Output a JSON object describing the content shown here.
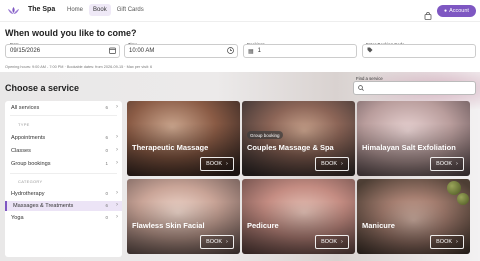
{
  "header": {
    "brand": "The Spa",
    "nav": [
      "Home",
      "Book",
      "Gift Cards"
    ],
    "account_label": "Account"
  },
  "when": {
    "title": "When would you like to come?",
    "date_label": "Date",
    "date_value": "09/15/2026",
    "time_label": "Time",
    "time_value": "10:00 AM",
    "bookings_label": "Bookings",
    "bookings_value": "1",
    "code_label": "Enter Booking Code",
    "hint": "Opening hours: 9:00 AM - 7:00 PM · Bookable dates: from 2026-09-15 · Max per visit: 6"
  },
  "choose": {
    "title": "Choose a service",
    "find_label": "Find a service",
    "find_placeholder": ""
  },
  "sidebar": {
    "all": {
      "label": "All services",
      "count": "6"
    },
    "type_head": "TYPE",
    "types": [
      {
        "label": "Appointments",
        "count": "6"
      },
      {
        "label": "Classes",
        "count": "0"
      },
      {
        "label": "Group bookings",
        "count": "1"
      }
    ],
    "cat_head": "CATEGORY",
    "cats": [
      {
        "label": "Hydrotherapy",
        "count": "0"
      },
      {
        "label": "Massages & Treatments",
        "count": "6"
      },
      {
        "label": "Yoga",
        "count": "0"
      }
    ]
  },
  "services": [
    {
      "title": "Therapeutic Massage",
      "book": "BOOK",
      "badge": ""
    },
    {
      "title": "Couples Massage & Spa",
      "book": "BOOK",
      "badge": "Group booking"
    },
    {
      "title": "Himalayan Salt Exfoliation",
      "book": "BOOK",
      "badge": ""
    },
    {
      "title": "Flawless Skin Facial",
      "book": "BOOK",
      "badge": ""
    },
    {
      "title": "Pedicure",
      "book": "BOOK",
      "badge": ""
    },
    {
      "title": "Manicure",
      "book": "BOOK",
      "badge": ""
    }
  ],
  "colors": {
    "accent": "#7e57c2"
  }
}
